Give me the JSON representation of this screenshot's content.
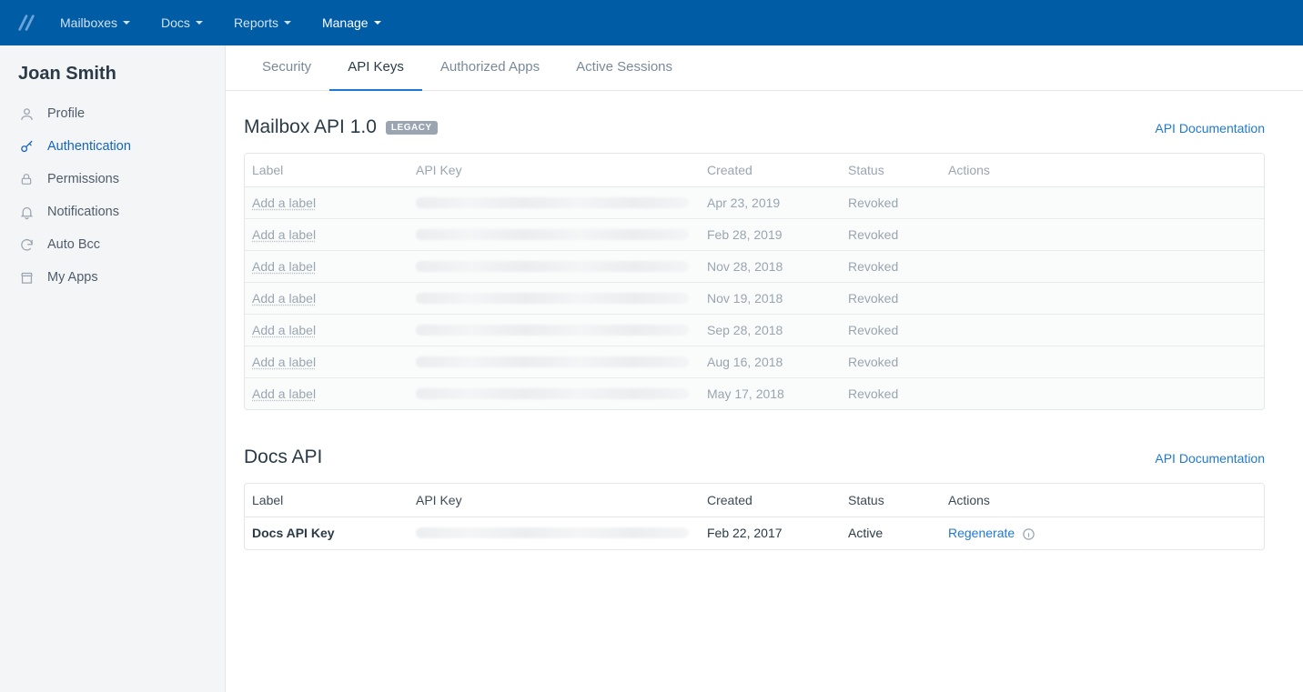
{
  "topnav": {
    "items": [
      {
        "label": "Mailboxes",
        "active": false
      },
      {
        "label": "Docs",
        "active": false
      },
      {
        "label": "Reports",
        "active": false
      },
      {
        "label": "Manage",
        "active": true
      }
    ]
  },
  "sidebar": {
    "title": "Joan Smith",
    "items": [
      {
        "label": "Profile",
        "icon": "user-icon",
        "active": false
      },
      {
        "label": "Authentication",
        "icon": "key-icon",
        "active": true
      },
      {
        "label": "Permissions",
        "icon": "lock-icon",
        "active": false
      },
      {
        "label": "Notifications",
        "icon": "bell-icon",
        "active": false
      },
      {
        "label": "Auto Bcc",
        "icon": "loop-icon",
        "active": false
      },
      {
        "label": "My Apps",
        "icon": "store-icon",
        "active": false
      }
    ]
  },
  "tabs": [
    {
      "label": "Security",
      "active": false
    },
    {
      "label": "API Keys",
      "active": true
    },
    {
      "label": "Authorized Apps",
      "active": false
    },
    {
      "label": "Active Sessions",
      "active": false
    }
  ],
  "mailbox_section": {
    "title": "Mailbox API 1.0",
    "badge": "LEGACY",
    "doc_link": "API Documentation",
    "columns": {
      "label": "Label",
      "key": "API Key",
      "created": "Created",
      "status": "Status",
      "actions": "Actions"
    },
    "rows": [
      {
        "label": "Add a label",
        "created": "Apr 23, 2019",
        "status": "Revoked"
      },
      {
        "label": "Add a label",
        "created": "Feb 28, 2019",
        "status": "Revoked"
      },
      {
        "label": "Add a label",
        "created": "Nov 28, 2018",
        "status": "Revoked"
      },
      {
        "label": "Add a label",
        "created": "Nov 19, 2018",
        "status": "Revoked"
      },
      {
        "label": "Add a label",
        "created": "Sep 28, 2018",
        "status": "Revoked"
      },
      {
        "label": "Add a label",
        "created": "Aug 16, 2018",
        "status": "Revoked"
      },
      {
        "label": "Add a label",
        "created": "May 17, 2018",
        "status": "Revoked"
      }
    ]
  },
  "docs_section": {
    "title": "Docs API",
    "doc_link": "API Documentation",
    "columns": {
      "label": "Label",
      "key": "API Key",
      "created": "Created",
      "status": "Status",
      "actions": "Actions"
    },
    "rows": [
      {
        "label": "Docs API Key",
        "created": "Feb 22, 2017",
        "status": "Active",
        "action": "Regenerate"
      }
    ]
  }
}
